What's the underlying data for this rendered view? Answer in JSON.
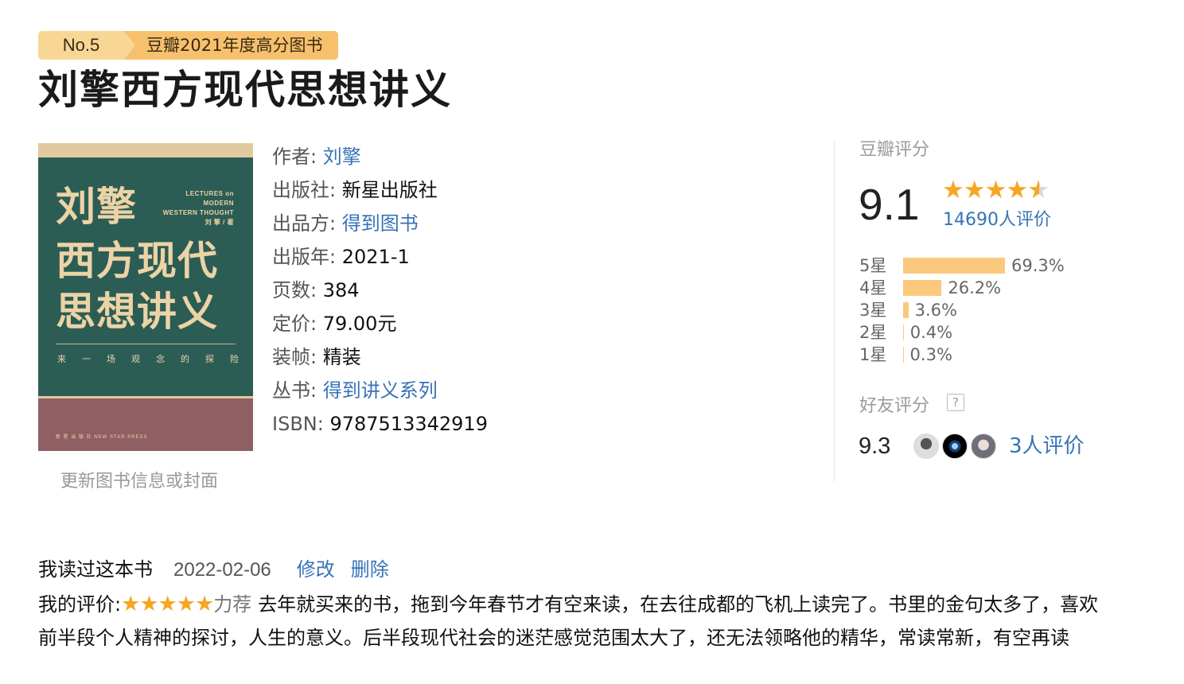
{
  "badge": {
    "rank": "No.5",
    "text": "豆瓣2021年度高分图书"
  },
  "book": {
    "title": "刘擎西方现代思想讲义"
  },
  "cover": {
    "title_lines": [
      "刘擎",
      "西方现代",
      "思想讲义"
    ],
    "en_lines": [
      "LECTURES on",
      "MODERN",
      "WESTERN THOUGHT",
      "刘 擎 / 著"
    ],
    "subtitle": "来一场观念的探险",
    "publisher": "新 星 出 版 社   NEW STAR PRESS",
    "colors": {
      "green": "#2b5d55",
      "gold": "#e3c9a0",
      "mauve": "#8f5f64"
    }
  },
  "update_link": "更新图书信息或封面",
  "info": [
    {
      "label": "作者:",
      "value": "刘擎",
      "link": true
    },
    {
      "label": "出版社:",
      "value": "新星出版社",
      "link": false
    },
    {
      "label": "出品方:",
      "value": "得到图书",
      "link": true
    },
    {
      "label": "出版年:",
      "value": "2021-1",
      "link": false
    },
    {
      "label": "页数:",
      "value": "384",
      "link": false
    },
    {
      "label": "定价:",
      "value": "79.00元",
      "link": false
    },
    {
      "label": "装帧:",
      "value": "精装",
      "link": false
    },
    {
      "label": "丛书:",
      "value": "得到讲义系列",
      "link": true
    },
    {
      "label": "ISBN:",
      "value": "9787513342919",
      "link": false
    }
  ],
  "rating": {
    "title": "豆瓣评分",
    "score": "9.1",
    "stars": 4.5,
    "count_text": "14690人评价",
    "distribution": [
      {
        "label": "5星",
        "pct": "69.3%",
        "value": 69.3
      },
      {
        "label": "4星",
        "pct": "26.2%",
        "value": 26.2
      },
      {
        "label": "3星",
        "pct": "3.6%",
        "value": 3.6
      },
      {
        "label": "2星",
        "pct": "0.4%",
        "value": 0.4
      },
      {
        "label": "1星",
        "pct": "0.3%",
        "value": 0.3
      }
    ]
  },
  "friends": {
    "title": "好友评分",
    "help": "?",
    "score": "9.3",
    "count_text": "3人评价"
  },
  "my_review": {
    "status": "我读过这本书",
    "date": "2022-02-06",
    "edit": "修改",
    "delete": "删除",
    "label": "我的评价:",
    "stars": 5,
    "recommend": "力荐",
    "text": "去年就买来的书，拖到今年春节才有空来读，在去往成都的飞机上读完了。书里的金句太多了，喜欢前半段个人精神的探讨，人生的意义。后半段现代社会的迷茫感觉范围太大了，还无法领略他的精华，常读常新，有空再读"
  },
  "colors": {
    "link": "#3773b6",
    "star": "#f5a623",
    "bar": "#fbc97c",
    "badge_light": "#f8d694",
    "badge_dark": "#f6c06d"
  }
}
